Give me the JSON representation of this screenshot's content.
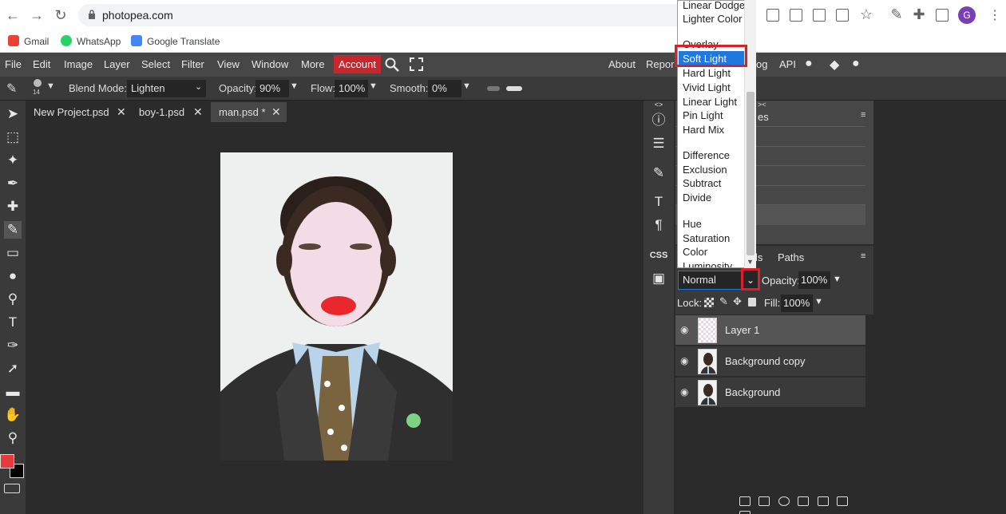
{
  "browser": {
    "url": "photopea.com",
    "profile_initial": "G",
    "bookmarks": [
      "Gmail",
      "WhatsApp",
      "Google Translate"
    ]
  },
  "menu": {
    "items": [
      "File",
      "Edit",
      "Image",
      "Layer",
      "Select",
      "Filter",
      "View",
      "Window",
      "More"
    ],
    "account": "Account",
    "right_items": [
      "About",
      "Repor",
      "og",
      "API"
    ]
  },
  "options": {
    "brush_size": "14",
    "blend_mode_label": "Blend Mode:",
    "blend_mode_value": "Lighten",
    "opacity_label": "Opacity:",
    "opacity_value": "90%",
    "flow_label": "Flow:",
    "flow_value": "100%",
    "smooth_label": "Smooth:",
    "smooth_value": "0%"
  },
  "tabs": [
    {
      "label": "New Project.psd"
    },
    {
      "label": "boy-1.psd"
    },
    {
      "label": "man.psd *"
    }
  ],
  "side_strip": {
    "css_label": "CSS"
  },
  "panels": {
    "upper_fragment": "es",
    "layers_tab_fragment": "ls",
    "paths_tab": "Paths"
  },
  "layers_controls": {
    "blend_value": "Normal",
    "opacity_label": "Opacity:",
    "opacity_value": "100%",
    "lock_label": "Lock:",
    "fill_label": "Fill:",
    "fill_value": "100%"
  },
  "layers": [
    {
      "name": "Layer 1",
      "active": true
    },
    {
      "name": "Background copy",
      "active": false
    },
    {
      "name": "Background",
      "active": false
    }
  ],
  "blend_dropdown": {
    "items": [
      "Linear Dodge",
      "Lighter Color",
      "Overlay",
      "Soft Light",
      "Hard Light",
      "Vivid Light",
      "Linear Light",
      "Pin Light",
      "Hard Mix",
      "Difference",
      "Exclusion",
      "Subtract",
      "Divide",
      "Hue",
      "Saturation",
      "Color",
      "Luminosity"
    ],
    "selected": "Soft Light"
  },
  "colors": {
    "account_red": "#c8262d",
    "selection_blue": "#1e78e0",
    "highlight_red": "#d8202b",
    "foreground_swatch": "#e8393c"
  }
}
